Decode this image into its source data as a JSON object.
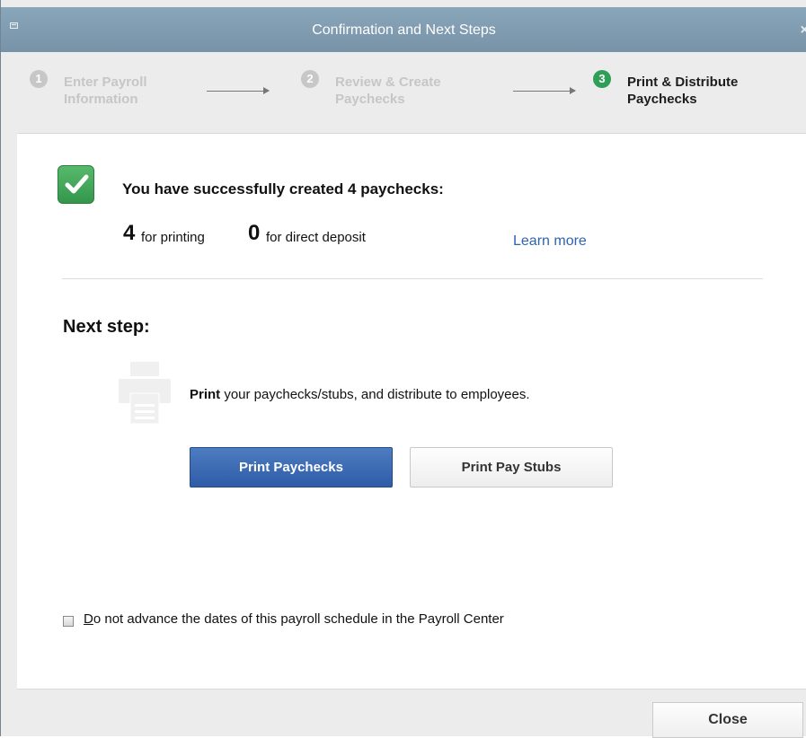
{
  "window": {
    "title": "Confirmation and Next Steps",
    "close_glyph": "×"
  },
  "steps": [
    {
      "number": "1",
      "line1": "Enter Payroll",
      "line2": "Information",
      "state": "done"
    },
    {
      "number": "2",
      "line1": "Review & Create",
      "line2": "Paychecks",
      "state": "done"
    },
    {
      "number": "3",
      "line1": "Print & Distribute",
      "line2": "Paychecks",
      "state": "active"
    }
  ],
  "confirmation": {
    "message": "You have successfully created 4 paychecks:",
    "printing_count": "4",
    "printing_label": "for printing",
    "deposit_count": "0",
    "deposit_label": "for direct deposit",
    "learn_more": "Learn more"
  },
  "next_step": {
    "heading": "Next step:",
    "icon": "printer-icon",
    "desc_bold": "Print",
    "desc_rest": " your paychecks/stubs, and distribute to employees.",
    "primary_button": "Print Paychecks",
    "secondary_button": "Print Pay Stubs"
  },
  "option": {
    "checked": false,
    "label_first": "D",
    "label_rest": "o not advance the dates of this payroll schedule in the Payroll Center"
  },
  "footer": {
    "close_label": "Close"
  },
  "colors": {
    "active_step": "#2f9e57",
    "primary_button": "#2e5ca8",
    "link": "#2e63b5"
  }
}
